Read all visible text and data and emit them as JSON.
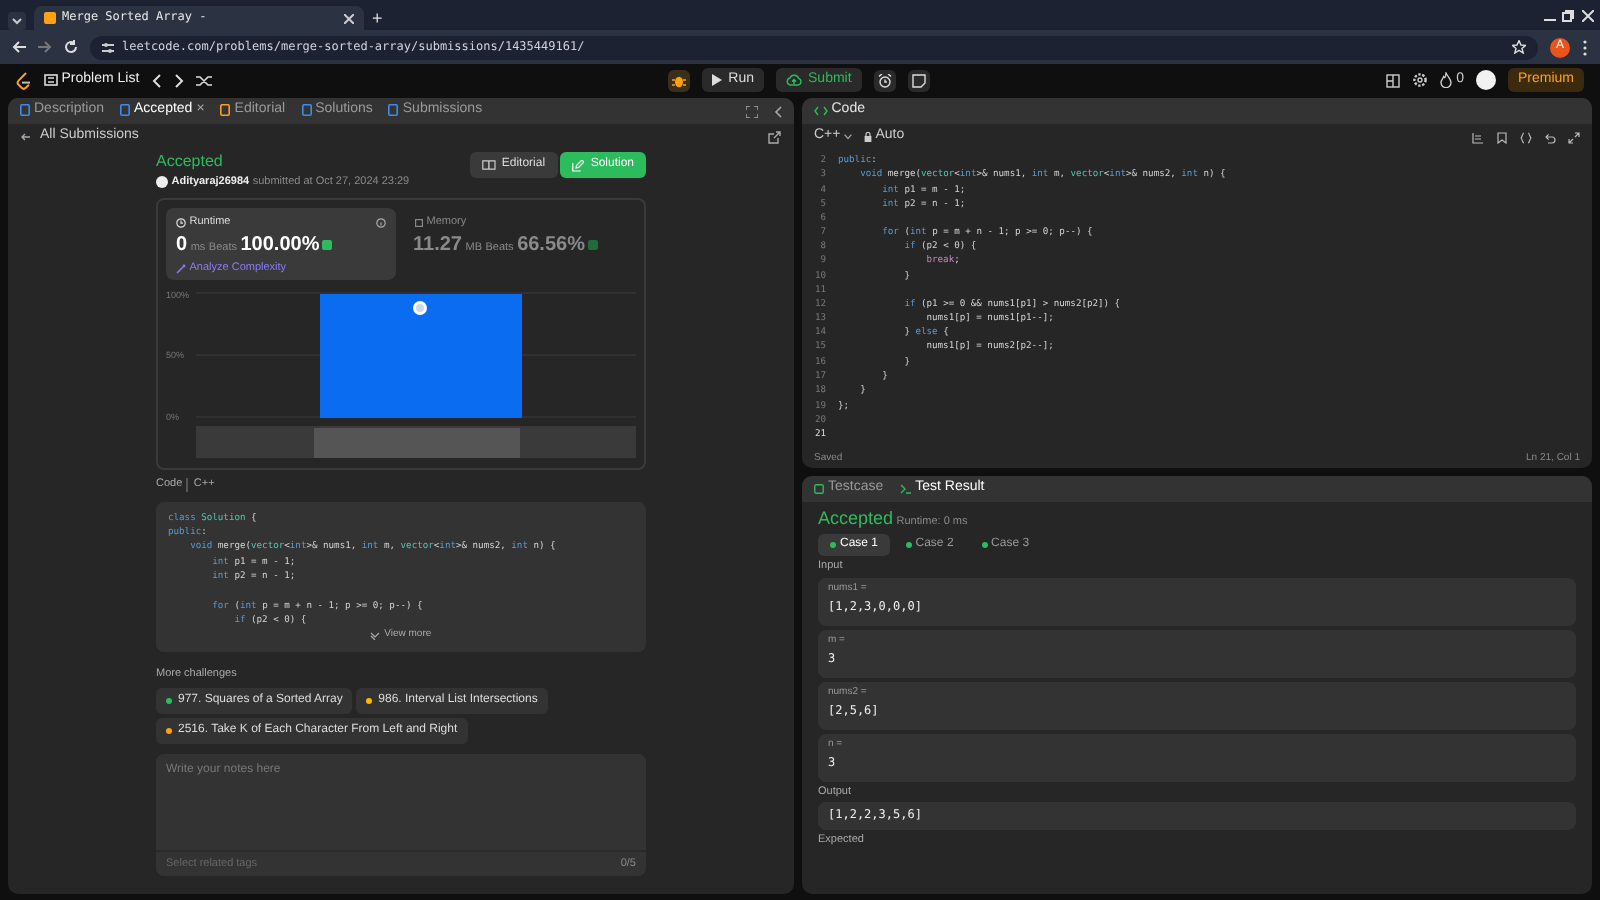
{
  "browser": {
    "tab_title": "Merge Sorted Array -",
    "new_tab": "+",
    "url": "leetcode.com/problems/merge-sorted-array/submissions/1435449161/",
    "profile": "A"
  },
  "topbar": {
    "problem_list": "Problem List",
    "run": "Run",
    "submit": "Submit",
    "streak": "0",
    "premium": "Premium"
  },
  "left_tabs": [
    {
      "label": "Description",
      "selected": false
    },
    {
      "label": "Accepted",
      "selected": true,
      "close": "×"
    },
    {
      "label": "Editorial",
      "selected": false
    },
    {
      "label": "Solutions",
      "selected": false
    },
    {
      "label": "Submissions",
      "selected": false
    }
  ],
  "back_link": "All Submissions",
  "submission": {
    "status": "Accepted",
    "user": "Adityaraj26984",
    "submitted": "submitted at Oct 27, 2024 23:29",
    "editorial_button": "Editorial",
    "solution_button": "Solution"
  },
  "metrics": [
    {
      "label": "Runtime",
      "value": "0",
      "unit": "ms",
      "beats_label": "Beats",
      "beats": "100.00%",
      "selected": true,
      "link": "Analyze Complexity"
    },
    {
      "label": "Memory",
      "value": "11.27",
      "unit": "MB",
      "beats_label": "Beats",
      "beats": "66.56%",
      "selected": false
    }
  ],
  "chart": {
    "y_labels": [
      "100%",
      "50%",
      "0%"
    ]
  },
  "code_heading": "Code",
  "code_lang": "C++",
  "code_preview": [
    {
      "tokens": [
        {
          "kind": "kw",
          "text": "class "
        },
        {
          "kind": "type",
          "text": "Solution"
        },
        {
          "kind": "plain",
          "text": " {"
        }
      ]
    },
    {
      "tokens": [
        {
          "kind": "kw",
          "text": "public"
        },
        {
          "kind": "plain",
          "text": ":"
        }
      ]
    },
    {
      "tokens": [
        {
          "kind": "kw",
          "text": "    void "
        },
        {
          "kind": "plain",
          "text": "merge("
        },
        {
          "kind": "type",
          "text": "vector"
        },
        {
          "kind": "plain",
          "text": "<"
        },
        {
          "kind": "kw",
          "text": "int"
        },
        {
          "kind": "plain",
          "text": ">& nums1, "
        },
        {
          "kind": "kw",
          "text": "int "
        },
        {
          "kind": "plain",
          "text": "m, "
        },
        {
          "kind": "type",
          "text": "vector"
        },
        {
          "kind": "plain",
          "text": "<"
        },
        {
          "kind": "kw",
          "text": "int"
        },
        {
          "kind": "plain",
          "text": ">& nums2, "
        },
        {
          "kind": "kw",
          "text": "int "
        },
        {
          "kind": "plain",
          "text": "n) {"
        }
      ]
    },
    {
      "tokens": [
        {
          "kind": "kw",
          "text": "        int "
        },
        {
          "kind": "plain",
          "text": "p1 = m - 1;"
        }
      ]
    },
    {
      "tokens": [
        {
          "kind": "kw",
          "text": "        int "
        },
        {
          "kind": "plain",
          "text": "p2 = n - 1;"
        }
      ]
    },
    {
      "gap_before": true,
      "tokens": [
        {
          "kind": "kw",
          "text": "        for "
        },
        {
          "kind": "plain",
          "text": "("
        },
        {
          "kind": "kw",
          "text": "int "
        },
        {
          "kind": "plain",
          "text": "p = m + n - 1; p >= 0; p--) {"
        }
      ]
    },
    {
      "tokens": [
        {
          "kind": "kw",
          "text": "            if "
        },
        {
          "kind": "plain",
          "text": "(p2 < 0) {"
        }
      ]
    }
  ],
  "view_more": "View more",
  "more_challenges": {
    "title": "More challenges",
    "items": [
      {
        "label": "977. Squares of a Sorted Array",
        "color": "#2cbb5d"
      },
      {
        "label": "986. Interval List Intersections",
        "color": "#ffb800"
      },
      {
        "label": "2516. Take K of Each Character From Left and Right",
        "color": "#ffa116"
      }
    ]
  },
  "notes": {
    "placeholder": "Write your notes here",
    "tags_placeholder": "Select related tags",
    "counter": "0/5"
  },
  "editor": {
    "title": "Code",
    "language": "C++",
    "mode": "Auto",
    "lines": [
      {
        "n": "2",
        "tokens": [
          {
            "kind": "kw",
            "text": "public"
          },
          {
            "kind": "plain",
            "text": ":"
          }
        ]
      },
      {
        "n": "3",
        "tokens": [
          {
            "kind": "kw",
            "text": "    void "
          },
          {
            "kind": "plain",
            "text": "merge("
          },
          {
            "kind": "type",
            "text": "vector"
          },
          {
            "kind": "plain",
            "text": "<"
          },
          {
            "kind": "kw",
            "text": "int"
          },
          {
            "kind": "plain",
            "text": ">& nums1, "
          },
          {
            "kind": "kw",
            "text": "int "
          },
          {
            "kind": "plain",
            "text": "m, "
          },
          {
            "kind": "type",
            "text": "vector"
          },
          {
            "kind": "plain",
            "text": "<"
          },
          {
            "kind": "kw",
            "text": "int"
          },
          {
            "kind": "plain",
            "text": ">& nums2, "
          },
          {
            "kind": "kw",
            "text": "int "
          },
          {
            "kind": "plain",
            "text": "n) {"
          }
        ]
      },
      {
        "n": "4",
        "tokens": [
          {
            "kind": "kw",
            "text": "        int "
          },
          {
            "kind": "plain",
            "text": "p1 = m - 1;"
          }
        ]
      },
      {
        "n": "5",
        "tokens": [
          {
            "kind": "kw",
            "text": "        int "
          },
          {
            "kind": "plain",
            "text": "p2 = n - 1;"
          }
        ]
      },
      {
        "n": "6"
      },
      {
        "n": "7",
        "tokens": [
          {
            "kind": "kw",
            "text": "        for "
          },
          {
            "kind": "plain",
            "text": "("
          },
          {
            "kind": "kw",
            "text": "int "
          },
          {
            "kind": "plain",
            "text": "p = m + n - 1; p >= 0; p--) {"
          }
        ]
      },
      {
        "n": "8",
        "tokens": [
          {
            "kind": "kw",
            "text": "            if "
          },
          {
            "kind": "plain",
            "text": "(p2 < 0) {"
          }
        ]
      },
      {
        "n": "9",
        "tokens": [
          {
            "kind": "ctl",
            "text": "                break"
          },
          {
            "kind": "plain",
            "text": ";"
          }
        ]
      },
      {
        "n": "10",
        "tokens": [
          {
            "kind": "plain",
            "text": "            }"
          }
        ]
      },
      {
        "n": "11"
      },
      {
        "n": "12",
        "tokens": [
          {
            "kind": "kw",
            "text": "            if "
          },
          {
            "kind": "plain",
            "text": "(p1 >= 0 && nums1[p1] > nums2[p2]) {"
          }
        ]
      },
      {
        "n": "13",
        "tokens": [
          {
            "kind": "plain",
            "text": "                nums1[p] = nums1[p1--];"
          }
        ]
      },
      {
        "n": "14",
        "tokens": [
          {
            "kind": "plain",
            "text": "            } "
          },
          {
            "kind": "kw",
            "text": "else "
          },
          {
            "kind": "plain",
            "text": "{"
          }
        ]
      },
      {
        "n": "15",
        "tokens": [
          {
            "kind": "plain",
            "text": "                nums1[p] = nums2[p2--];"
          }
        ]
      },
      {
        "n": "16",
        "tokens": [
          {
            "kind": "plain",
            "text": "            }"
          }
        ]
      },
      {
        "n": "17",
        "tokens": [
          {
            "kind": "plain",
            "text": "        }"
          }
        ]
      },
      {
        "n": "18",
        "tokens": [
          {
            "kind": "plain",
            "text": "    }"
          }
        ]
      },
      {
        "n": "19",
        "tokens": [
          {
            "kind": "plain",
            "text": "};"
          }
        ]
      },
      {
        "n": "20"
      },
      {
        "n": "21"
      }
    ],
    "status": "Saved",
    "cursor": "Ln 21, Col 1"
  },
  "result": {
    "tabs": [
      {
        "label": "Testcase",
        "selected": false
      },
      {
        "label": "Test Result",
        "selected": true
      }
    ],
    "verdict": "Accepted",
    "runtime": "Runtime: 0 ms",
    "cases": [
      {
        "label": "Case 1",
        "selected": true
      },
      {
        "label": "Case 2",
        "selected": false
      },
      {
        "label": "Case 3",
        "selected": false
      }
    ],
    "input_label": "Input",
    "inputs": [
      {
        "name": "nums1 =",
        "value": "[1,2,3,0,0,0]"
      },
      {
        "name": "m =",
        "value": "3"
      },
      {
        "name": "nums2 =",
        "value": "[2,5,6]"
      },
      {
        "name": "n =",
        "value": "3"
      }
    ],
    "output_label": "Output",
    "output": "[1,2,2,3,5,6]",
    "expected_label": "Expected"
  }
}
